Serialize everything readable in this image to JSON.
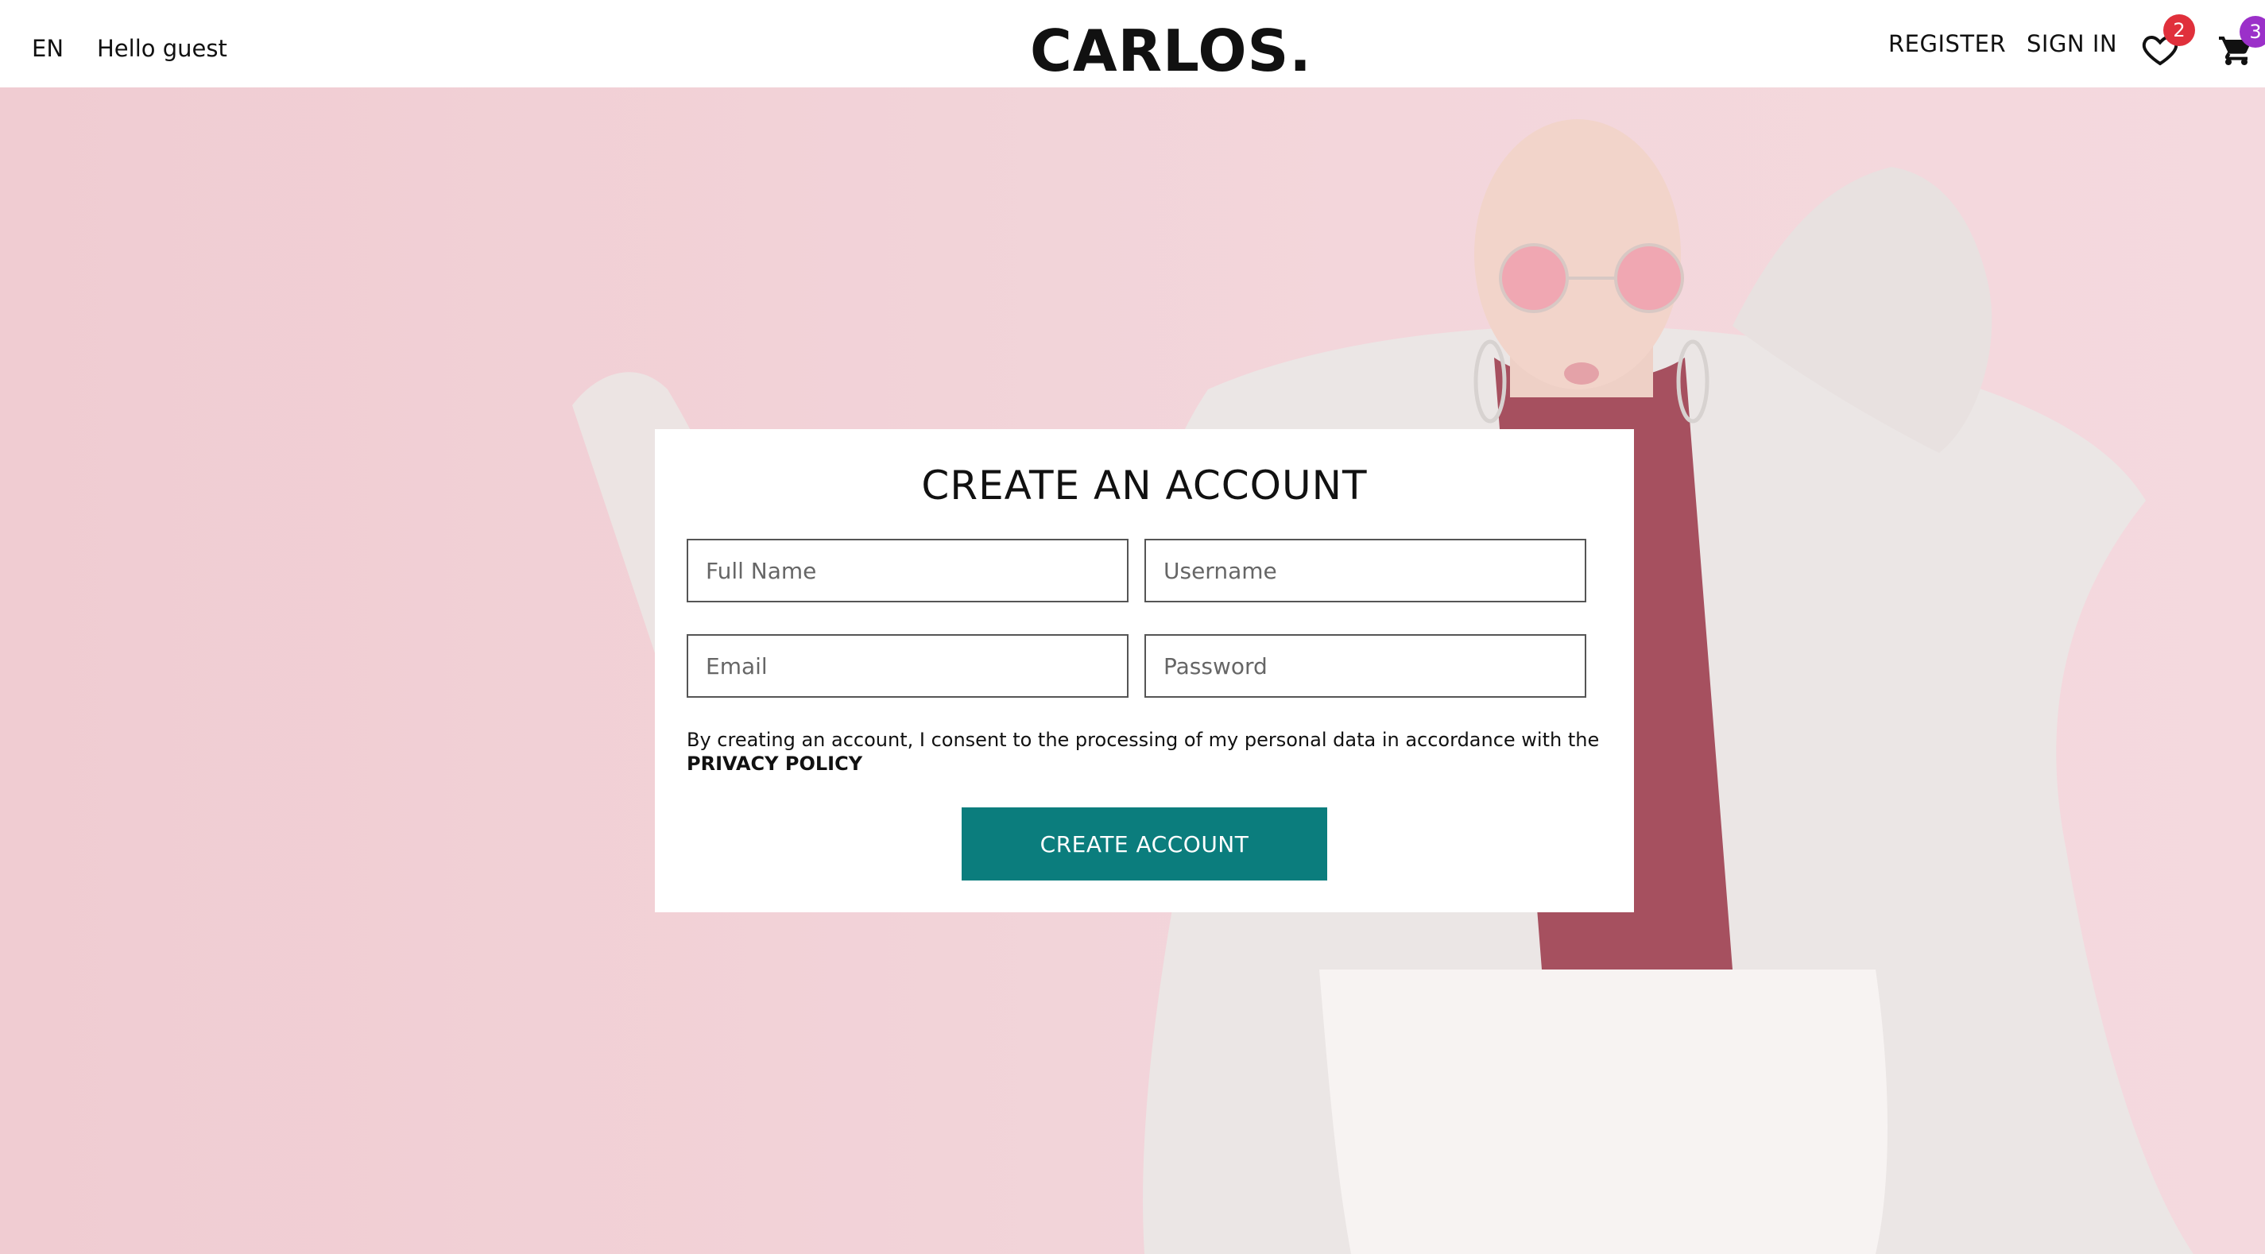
{
  "header": {
    "language": "EN",
    "greeting": "Hello guest",
    "logo": "CARLOS.",
    "register_label": "REGISTER",
    "signin_label": "SIGN IN",
    "wishlist_count": "2",
    "cart_count": "3",
    "wishlist_badge_color": "#e0303b",
    "cart_badge_color": "#9b30c9"
  },
  "hero": {
    "background_color": "#f2d3d8"
  },
  "form": {
    "title": "CREATE AN ACCOUNT",
    "fullname_placeholder": "Full Name",
    "username_placeholder": "Username",
    "email_placeholder": "Email",
    "password_placeholder": "Password",
    "consent_text": "By creating an account, I consent to the processing of my personal data in accordance with the",
    "privacy_link": "PRIVACY POLICY",
    "submit_label": "CREATE ACCOUNT",
    "submit_color": "#0b7d7d"
  }
}
